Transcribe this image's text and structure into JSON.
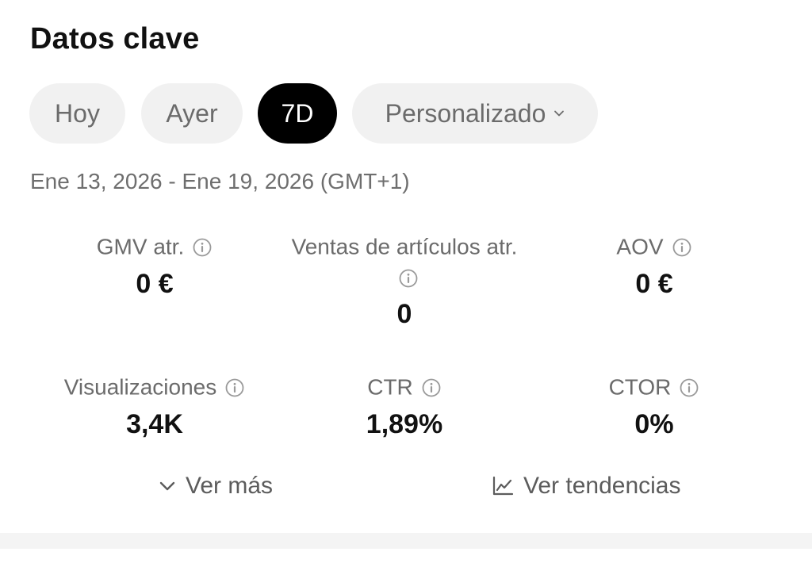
{
  "title": "Datos clave",
  "tabs": [
    {
      "label": "Hoy",
      "active": false
    },
    {
      "label": "Ayer",
      "active": false
    },
    {
      "label": "7D",
      "active": true
    },
    {
      "label": "Personalizado",
      "active": false
    }
  ],
  "date_range": "Ene 13, 2026 - Ene 19, 2026 (GMT+1)",
  "metrics": {
    "gmv": {
      "label": "GMV atr.",
      "value": "0 €"
    },
    "ventas": {
      "label": "Ventas de artículos atr.",
      "value": "0"
    },
    "aov": {
      "label": "AOV",
      "value": "0 €"
    },
    "visualizaciones": {
      "label": "Visualizaciones",
      "value": "3,4K"
    },
    "ctr": {
      "label": "CTR",
      "value": "1,89%"
    },
    "ctor": {
      "label": "CTOR",
      "value": "0%"
    }
  },
  "footer": {
    "ver_mas": "Ver más",
    "ver_tendencias": "Ver tendencias"
  },
  "icons": {
    "info": "info-icon",
    "chevron": "chevron-down-icon",
    "trend": "trend-chart-icon"
  },
  "colors": {
    "active_tab_bg": "#000000",
    "inactive_tab_bg": "#f1f1f1",
    "muted_text": "#6b6b6b"
  }
}
